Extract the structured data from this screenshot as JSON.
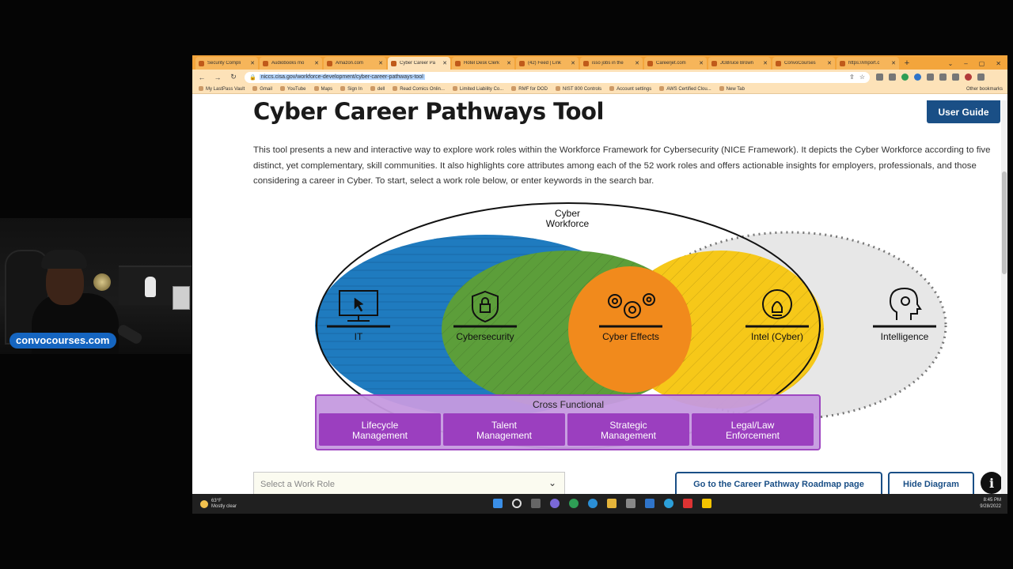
{
  "overlay": {
    "brand": "convocourses.com"
  },
  "browser": {
    "tabs": [
      {
        "label": "Security Compli",
        "active": false
      },
      {
        "label": "Audiobooks mo",
        "active": false
      },
      {
        "label": "Amazon.com",
        "active": false
      },
      {
        "label": "Cyber Career Pa",
        "active": true
      },
      {
        "label": "Hotel Desk Clerk",
        "active": false
      },
      {
        "label": "(42) Feed | Link",
        "active": false
      },
      {
        "label": "isso jobs in the",
        "active": false
      },
      {
        "label": "Careerjet.com",
        "active": false
      },
      {
        "label": "JGBruce Brown",
        "active": false
      },
      {
        "label": "ConvoCourses",
        "active": false
      },
      {
        "label": "https://import.c",
        "active": false
      }
    ],
    "new_tab": "+",
    "window_controls": [
      "⌄",
      "–",
      "▢",
      "✕"
    ],
    "url": "niccs.cisa.gov/workforce-development/cyber-career-pathways-tool",
    "bookmarks": [
      "My LastPass Vault",
      "Gmail",
      "YouTube",
      "Maps",
      "Sign In",
      "dell",
      "Read Comics Onlin...",
      "Limited Liability Co...",
      "RMF for DOD",
      "NIST 800 Controls",
      "Account settings",
      "AWS Certified Clou...",
      "New Tab"
    ],
    "other_bookmarks": "Other bookmarks"
  },
  "page": {
    "title": "Cyber Career Pathways Tool",
    "user_guide": "User Guide",
    "description": "This tool presents a new and interactive way to explore work roles within the Workforce Framework for Cybersecurity (NICE Framework). It depicts the Cyber Workforce according to five distinct, yet complementary, skill communities. It also highlights core attributes among each of the 52 work roles and offers actionable insights for employers, professionals, and those considering a career in Cyber. To start, select a work role below, or enter keywords in the search bar.",
    "venn": {
      "outer_label_1": "Cyber",
      "outer_label_2": "Workforce",
      "communities": [
        "IT",
        "Cybersecurity",
        "Cyber Effects",
        "Intel (Cyber)",
        "Intelligence"
      ],
      "cross_functional": "Cross Functional",
      "cross_items": [
        [
          "Lifecycle",
          "Management"
        ],
        [
          "Talent",
          "Management"
        ],
        [
          "Strategic",
          "Management"
        ],
        [
          "Legal/Law",
          "Enforcement"
        ]
      ],
      "colors": {
        "it": "#1f7bbf",
        "cyber": "#5c9e3a",
        "effects": "#f18a1c",
        "intel": "#f6c819",
        "intelligence": "#e6e6e6",
        "cross": "#9b3fbf"
      }
    },
    "select_placeholder": "Select a Work Role",
    "roadmap_button": "Go to the Career Pathway Roadmap page",
    "hide_button": "Hide Diagram",
    "info_button": "i"
  },
  "taskbar": {
    "weather_temp": "63°F",
    "weather_desc": "Mostly clear",
    "time": "8:45 PM",
    "date": "9/28/2022"
  }
}
